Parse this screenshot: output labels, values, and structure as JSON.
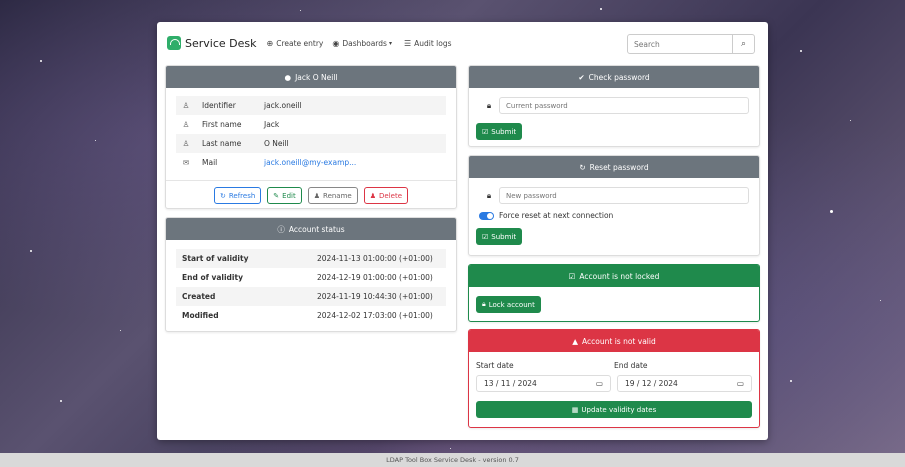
{
  "navbar": {
    "brand": "Service Desk",
    "links": [
      {
        "icon": "plus-circle-icon",
        "label": "Create entry"
      },
      {
        "icon": "dashboard-icon",
        "label": "Dashboards"
      },
      {
        "icon": "list-icon",
        "label": "Audit logs"
      }
    ],
    "search_placeholder": "Search"
  },
  "user_card": {
    "title": "Jack O Neill",
    "attributes": [
      {
        "icon": "person-icon",
        "label": "Identifier",
        "value": "jack.oneill"
      },
      {
        "icon": "person-icon",
        "label": "First name",
        "value": "Jack"
      },
      {
        "icon": "person-icon",
        "label": "Last name",
        "value": "O Neill"
      },
      {
        "icon": "mail-icon",
        "label": "Mail",
        "value": "jack.oneill@my-examp..."
      }
    ],
    "buttons": {
      "refresh": "Refresh",
      "edit": "Edit",
      "rename": "Rename",
      "delete": "Delete"
    }
  },
  "account_status": {
    "title": "Account status",
    "rows": [
      {
        "label": "Start of validity",
        "value": "2024-11-13 01:00:00 (+01:00)"
      },
      {
        "label": "End of validity",
        "value": "2024-12-19 01:00:00 (+01:00)"
      },
      {
        "label": "Created",
        "value": "2024-11-19 10:44:30 (+01:00)"
      },
      {
        "label": "Modified",
        "value": "2024-12-02 17:03:00 (+01:00)"
      }
    ]
  },
  "check_password": {
    "title": "Check password",
    "placeholder": "Current password",
    "submit": "Submit"
  },
  "reset_password": {
    "title": "Reset password",
    "placeholder": "New password",
    "force_reset_label": "Force reset at next connection",
    "force_reset_on": true,
    "submit": "Submit"
  },
  "lock_card": {
    "title": "Account is not locked",
    "button": "Lock account"
  },
  "validity_card": {
    "title": "Account is not valid",
    "start_label": "Start date",
    "end_label": "End date",
    "start_value": "13 / 11 / 2024",
    "end_value": "19 / 12 / 2024",
    "button": "Update validity dates"
  },
  "footer": "LDAP Tool Box Service Desk - version 0.7",
  "colors": {
    "green": "#1f8a4c",
    "red": "#dc3545",
    "grey_header": "#6c757d",
    "blue": "#2a7ae2"
  }
}
